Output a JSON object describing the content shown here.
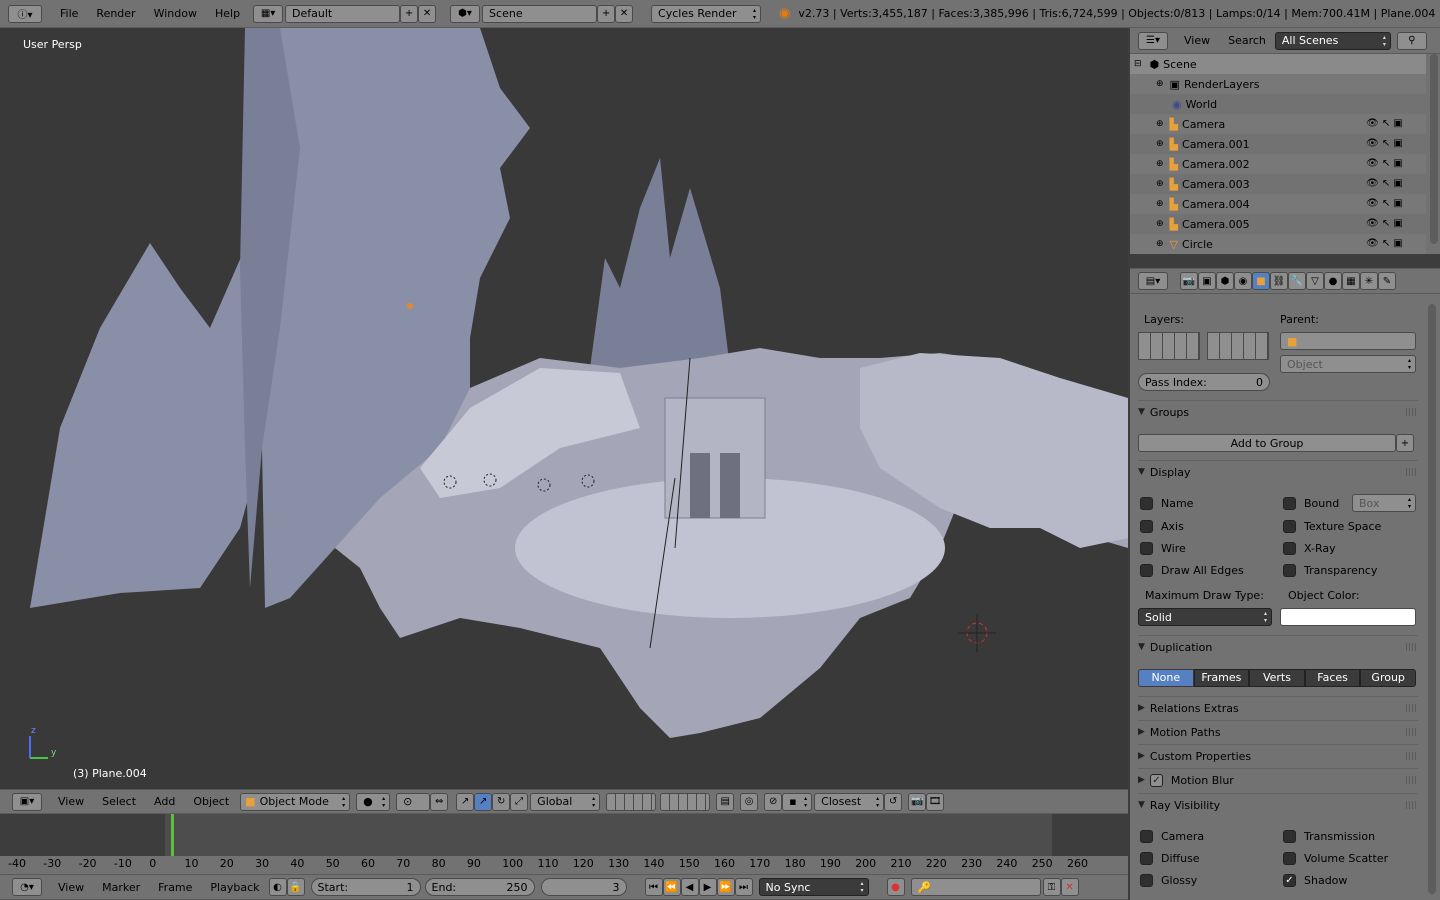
{
  "top_bar": {
    "menus": [
      "File",
      "Render",
      "Window",
      "Help"
    ],
    "screen_layout": "Default",
    "scene": "Scene",
    "render_engine": "Cycles Render",
    "stats": "v2.73 | Verts:3,455,187 | Faces:3,385,996 | Tris:6,724,599 | Objects:0/813 | Lamps:0/14 | Mem:700.41M | Plane.004"
  },
  "viewport": {
    "view_label": "User Persp",
    "object_label": "(3) Plane.004",
    "axis_z": "z",
    "axis_y": "y"
  },
  "viewport_header": {
    "menus": [
      "View",
      "Select",
      "Add",
      "Object"
    ],
    "mode": "Object Mode",
    "orientation": "Global",
    "snap_target": "Closest"
  },
  "outliner": {
    "header_menus": [
      "View",
      "Search"
    ],
    "filter": "All Scenes",
    "items": [
      {
        "label": "Scene",
        "indent": 0
      },
      {
        "label": "RenderLayers",
        "indent": 1
      },
      {
        "label": "World",
        "indent": 1
      },
      {
        "label": "Camera",
        "indent": 1
      },
      {
        "label": "Camera.001",
        "indent": 1
      },
      {
        "label": "Camera.002",
        "indent": 1
      },
      {
        "label": "Camera.003",
        "indent": 1
      },
      {
        "label": "Camera.004",
        "indent": 1
      },
      {
        "label": "Camera.005",
        "indent": 1
      },
      {
        "label": "Circle",
        "indent": 1
      }
    ]
  },
  "properties": {
    "layers_label": "Layers:",
    "parent_label": "Parent:",
    "parent_type": "Object",
    "pass_index_label": "Pass Index:",
    "pass_index_value": "0",
    "groups": {
      "title": "Groups",
      "add_button": "Add to Group"
    },
    "display": {
      "title": "Display",
      "left": [
        "Name",
        "Axis",
        "Wire",
        "Draw All Edges"
      ],
      "right": [
        "Bound",
        "Texture Space",
        "X-Ray",
        "Transparency"
      ],
      "bound_type": "Box",
      "max_draw_label": "Maximum Draw Type:",
      "max_draw_value": "Solid",
      "object_color_label": "Object Color:"
    },
    "duplication": {
      "title": "Duplication",
      "options": [
        "None",
        "Frames",
        "Verts",
        "Faces",
        "Group"
      ],
      "active": "None"
    },
    "collapsed_panels": [
      "Relations Extras",
      "Motion Paths",
      "Custom Properties",
      "Motion Blur"
    ],
    "ray_visibility": {
      "title": "Ray Visibility",
      "left": [
        "Camera",
        "Diffuse",
        "Glossy"
      ],
      "right": [
        "Transmission",
        "Volume Scatter",
        "Shadow"
      ]
    }
  },
  "timeline": {
    "ticks": [
      "-40",
      "-30",
      "-20",
      "-10",
      "0",
      "10",
      "20",
      "30",
      "40",
      "50",
      "60",
      "70",
      "80",
      "90",
      "100",
      "110",
      "120",
      "130",
      "140",
      "150",
      "160",
      "170",
      "180",
      "190",
      "200",
      "210",
      "220",
      "230",
      "240",
      "250",
      "260"
    ],
    "menus": [
      "View",
      "Marker",
      "Frame",
      "Playback"
    ],
    "start_label": "Start:",
    "start_value": "1",
    "end_label": "End:",
    "end_value": "250",
    "current_frame": "3",
    "sync": "No Sync"
  }
}
